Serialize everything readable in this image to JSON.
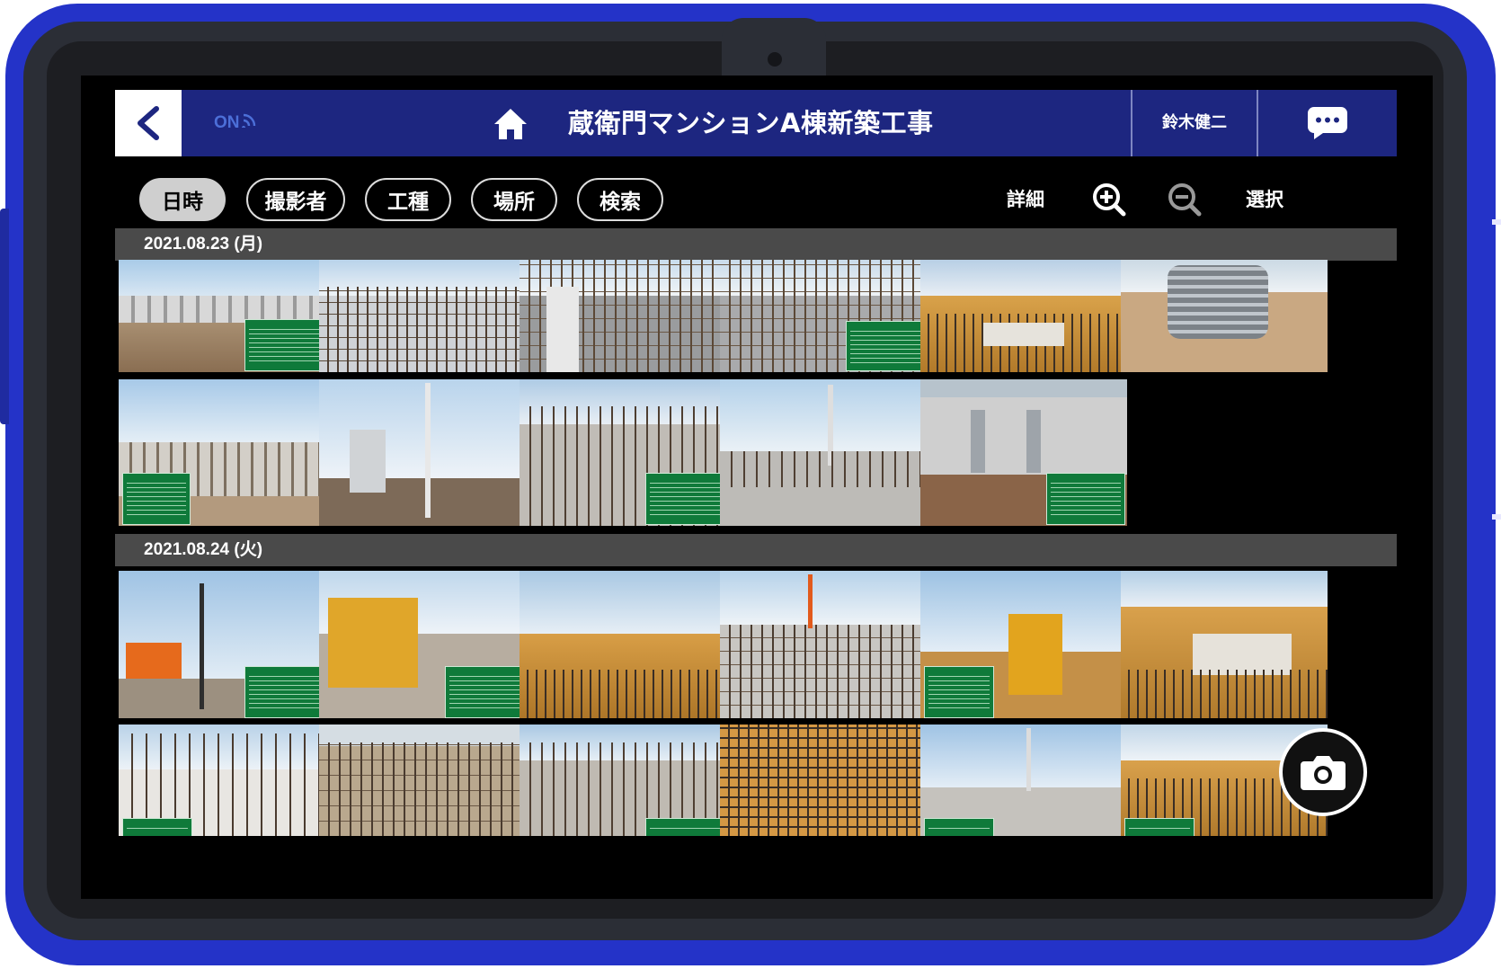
{
  "header": {
    "back_icon": "chevron-left-icon",
    "connection_status": "ON",
    "home_icon": "home-icon",
    "title": "蔵衛門マンションA棟新築工事",
    "user_name": "鈴木健二",
    "chat_icon": "chat-bubble-icon"
  },
  "toolbar": {
    "filters": [
      {
        "label": "日時",
        "active": true
      },
      {
        "label": "撮影者",
        "active": false
      },
      {
        "label": "工種",
        "active": false
      },
      {
        "label": "場所",
        "active": false
      },
      {
        "label": "検索",
        "active": false
      }
    ],
    "detail_label": "詳細",
    "zoom_in_icon": "zoom-in-icon",
    "zoom_out_icon": "zoom-out-icon",
    "select_label": "選択"
  },
  "gallery": {
    "groups": [
      {
        "date": "2021.08.23 (月)",
        "photo_count": 11
      },
      {
        "date": "2021.08.24 (火)",
        "photo_count": 12
      }
    ]
  },
  "camera_button": {
    "icon": "camera-icon"
  },
  "colors": {
    "case_blue": "#2433c8",
    "header_navy": "#1d2680",
    "board_green": "#0f7a3a"
  }
}
